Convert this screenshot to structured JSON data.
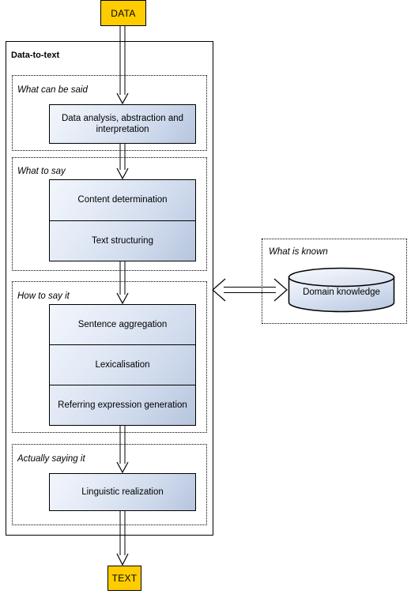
{
  "diagram": {
    "title": "Data-to-text",
    "type": "flowchart"
  },
  "terminals": {
    "input": {
      "label": "DATA",
      "color": "#ffcc00"
    },
    "output": {
      "label": "TEXT",
      "color": "#ffcc00"
    }
  },
  "groups": [
    {
      "id": "what-can-be-said",
      "label": "What can be said",
      "stages": [
        {
          "label": "Data analysis, abstraction and interpretation"
        }
      ]
    },
    {
      "id": "what-to-say",
      "label": "What to say",
      "stages": [
        {
          "label": "Content determination"
        },
        {
          "label": "Text structuring"
        }
      ]
    },
    {
      "id": "how-to-say-it",
      "label": "How to say it",
      "stages": [
        {
          "label": "Sentence aggregation"
        },
        {
          "label": "Lexicalisation"
        },
        {
          "label": "Referring expression generation"
        }
      ]
    },
    {
      "id": "actually-saying-it",
      "label": "Actually saying it",
      "stages": [
        {
          "label": "Linguistic realization"
        }
      ]
    }
  ],
  "knowledge": {
    "group_label": "What is known",
    "store_label": "Domain knowledge",
    "shape": "cylinder"
  },
  "colors": {
    "terminal_fill": "#ffcc00",
    "process_fill_light": "#f2f6fc",
    "process_fill_dark": "#b6c5de",
    "stroke": "#000000"
  }
}
